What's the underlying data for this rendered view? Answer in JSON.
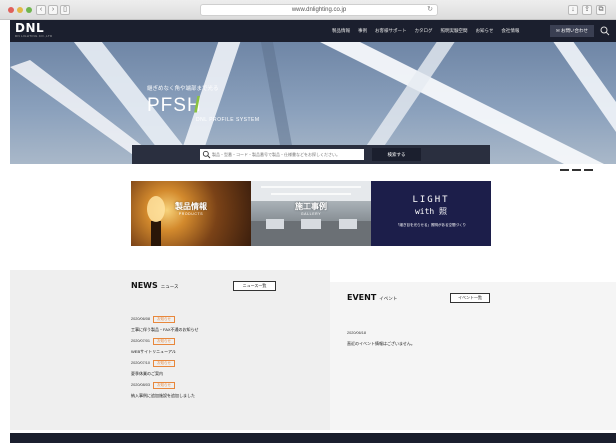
{
  "browser": {
    "url": "www.dnlighting.co.jp",
    "back_icon": "chevron-left-icon",
    "forward_icon": "chevron-right-icon"
  },
  "header": {
    "logo": "DNL",
    "logo_sub": "DN LIGHTING CO.,LTD",
    "nav": [
      "製品情報",
      "事例",
      "お客様サポート",
      "カタログ",
      "照明実験空間",
      "お知らせ",
      "会社情報"
    ],
    "contact_label": "お問い合わせ",
    "bg_color": "#1b1f2e"
  },
  "hero": {
    "tagline": "継ぎめなく角や端部まで光る",
    "title": "PFSH",
    "subtitle": "DNL PROFILE SYSTEM",
    "slash_color": "#8ac23f"
  },
  "search": {
    "placeholder": "製品・型番・コード・製品番号で製品・仕様書などをお探しください。",
    "button_label": "検索する"
  },
  "tiles": [
    {
      "title": "製品情報",
      "sub": "PRODUCTS"
    },
    {
      "title": "施工事例",
      "sub": "GALLERY"
    },
    {
      "title": "LIGHT",
      "title2": "with 照",
      "caption": "「継ぎ目を光らせる」照明がある空間づくり"
    }
  ],
  "news": {
    "heading": "NEWS",
    "heading_jp": "ニュース",
    "list_label": "ニュース一覧",
    "items": [
      {
        "date": "2020/06/08",
        "tag": "お知らせ",
        "text": "工事に伴う製品・FAX不通のお知らせ"
      },
      {
        "date": "2020/07/01",
        "tag": "お知らせ",
        "text": "WEBサイトリニューアル"
      },
      {
        "date": "2020/07/10",
        "tag": "お知らせ",
        "text": "夏季休業のご案内"
      },
      {
        "date": "2020/08/03",
        "tag": "お知らせ",
        "text": "納入事例に追加施設を追加しました"
      }
    ],
    "tag_color": "#e8873b"
  },
  "event": {
    "heading": "EVENT",
    "heading_jp": "イベント",
    "list_label": "イベント一覧",
    "items": [
      {
        "date": "2020/06/18",
        "text": "直近のイベント情報はございません。"
      }
    ]
  }
}
